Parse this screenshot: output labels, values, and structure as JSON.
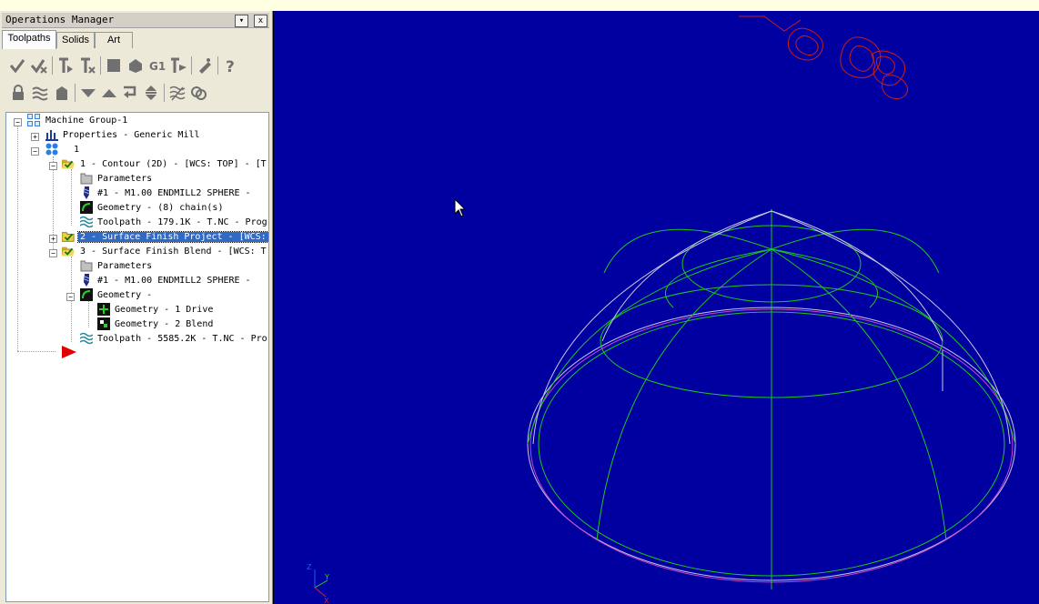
{
  "app": {
    "tooltip_fragment": ""
  },
  "panel": {
    "title": "Operations Manager",
    "buttons": {
      "dropdown": "▾",
      "close": "x"
    },
    "tabs": [
      {
        "label": "Toolpaths",
        "active": true
      },
      {
        "label": "Solids",
        "active": false
      },
      {
        "label": "Art",
        "active": false
      }
    ],
    "toolbar1": [
      "select-all-icon",
      "select-dirty-icon",
      "regenerate-icon",
      "regenerate-dirty-icon",
      "backplot-icon",
      "verify-icon",
      "g1-post-icon",
      "post-selected-icon",
      "high-speed-toggle-icon",
      "help-icon"
    ],
    "toolbar2": [
      "lock-icon",
      "toggle-display-icon",
      "posting-lock-icon",
      "move-down-icon",
      "move-up-icon",
      "insert-pointer-icon",
      "scroll-icon",
      "toolpath-display-icon",
      "expand-icon"
    ]
  },
  "tree": {
    "machine_group": "Machine Group-1",
    "properties": "Properties - Generic Mill",
    "group_1": "1",
    "op1": "1 - Contour (2D) - [WCS: TOP] - [T",
    "op1_params": "Parameters",
    "op1_tool": "#1 - M1.00 ENDMILL2 SPHERE -",
    "op1_geometry": "Geometry - (8) chain(s)",
    "op1_toolpath": "Toolpath - 179.1K - T.NC - Prog",
    "op2": "2 - Surface Finish Project - [WCS:",
    "op3": "3 - Surface Finish Blend - [WCS: T",
    "op3_params": "Parameters",
    "op3_tool": "#1 - M1.00 ENDMILL2 SPHERE -",
    "op3_geometry": "Geometry -",
    "op3_geo_drive": "Geometry - 1 Drive",
    "op3_geo_blend": "Geometry - 2 Blend",
    "op3_toolpath": "Toolpath - 5585.2K - T.NC - Pro"
  },
  "viewport": {
    "background": "#0000a0",
    "wire_color": "#1ec81e",
    "sketch_color": "#c81e1e",
    "outline_color": "#c8c8e6",
    "axis": {
      "z": "Z",
      "y": "Y",
      "x": "X"
    }
  }
}
